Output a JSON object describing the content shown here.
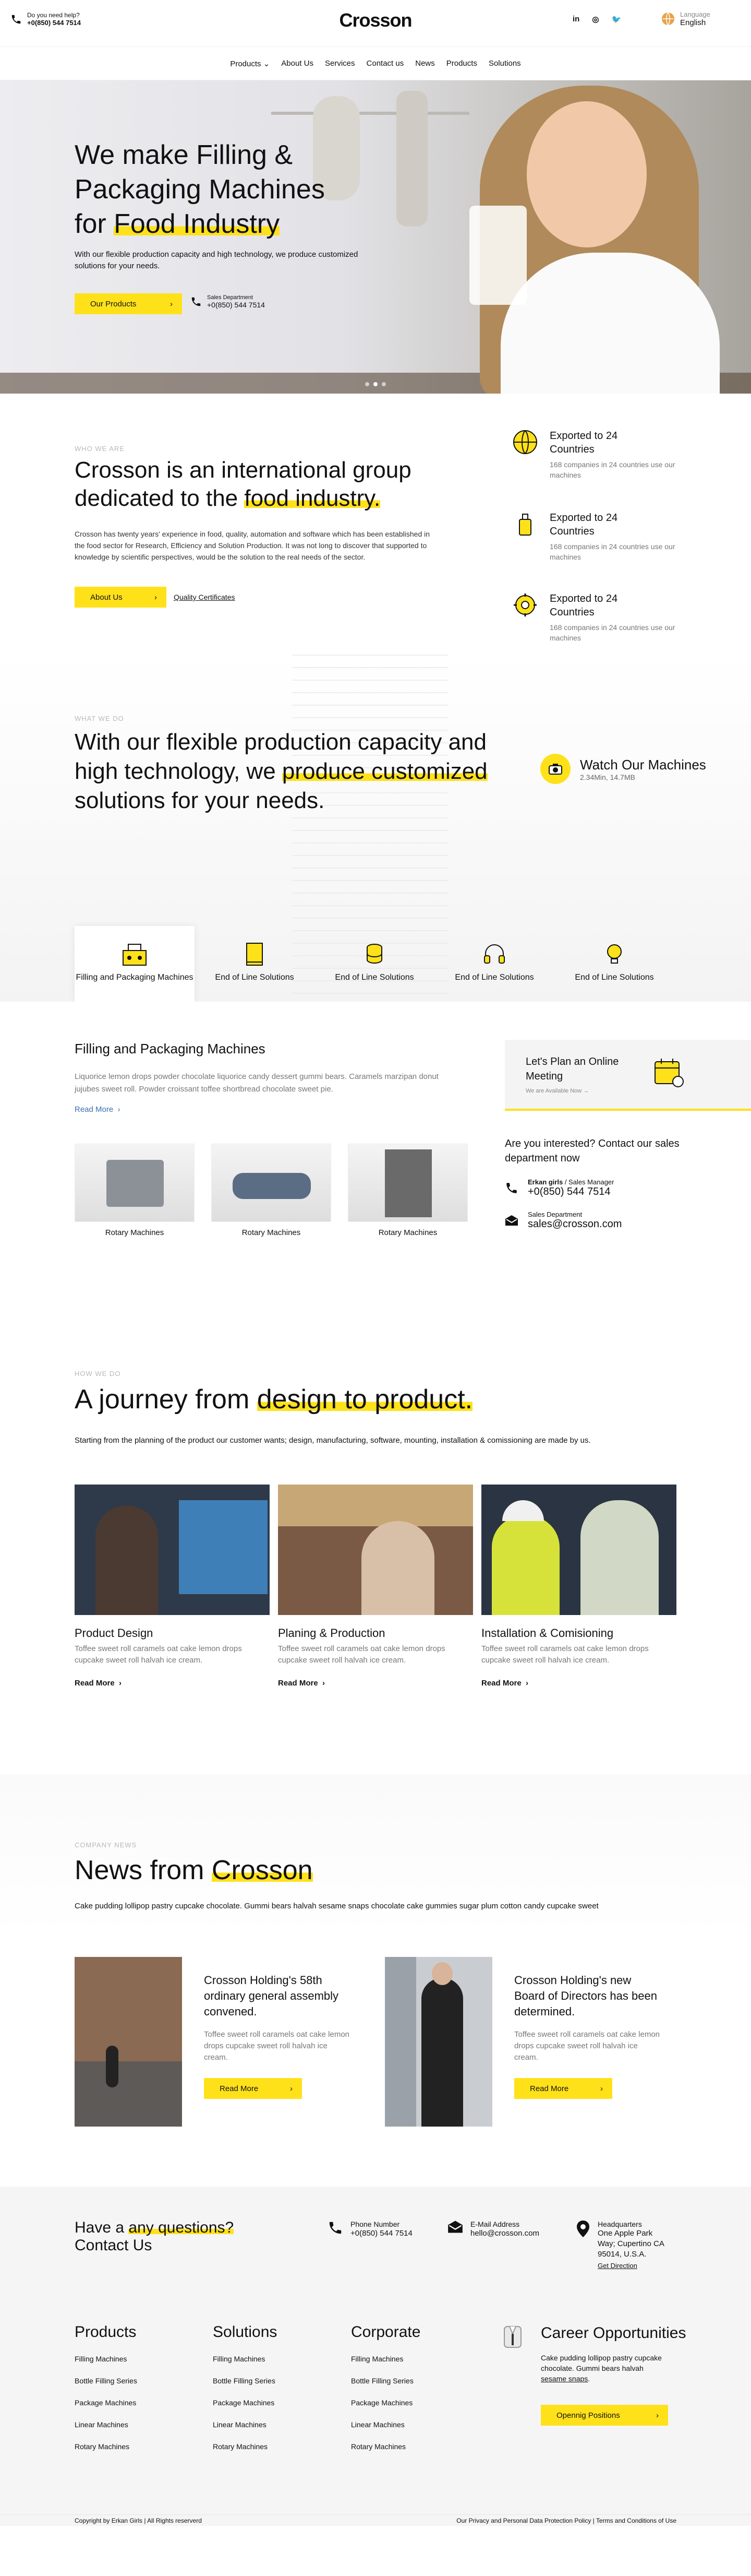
{
  "header": {
    "need_help": "Do you need help?",
    "phone": "+0(850) 544 7514",
    "logo": "Crosson",
    "socials": [
      "in",
      "◎",
      "🐦"
    ],
    "language_label": "Language",
    "language_value": "English"
  },
  "nav": {
    "items": [
      "Products",
      "About Us",
      "Services",
      "Contact us",
      "News",
      "Products",
      "Solutions"
    ]
  },
  "hero": {
    "title_line1": "We make Filling &",
    "title_line2": "Packaging Machines",
    "title_line3_prefix": "for ",
    "title_line3_highlight": "Food Industry",
    "subtitle": "With our flexible production capacity and high technology, we produce customized solutions for your needs.",
    "button": "Our Products",
    "sales_label": "Sales Department",
    "sales_phone": "+0(850) 544 7514",
    "active_slide": 2,
    "slides": 3
  },
  "who": {
    "eyebrow": "WHO WE ARE",
    "title_prefix": "Crosson is an international group dedicated to the ",
    "title_highlight": "food industry.",
    "text": "Crosson has twenty years' experience in food, quality, automation and software which has been established in the food sector for Research, Efficiency and Solution Production. It was not long to discover that supported to knowledge by scientific perspectives, would be the solution to the real needs of the sector.",
    "button": "About Us",
    "link": "Quality Certificates",
    "features": [
      {
        "icon": "globe-icon",
        "title": "Exported to 24 Countries",
        "desc": "168 companies in 24 countries use our machines"
      },
      {
        "icon": "bottle-icon",
        "title": "Exported to 24 Countries",
        "desc": "168 companies in 24 countries use our machines"
      },
      {
        "icon": "gear-icon",
        "title": "Exported to 24 Countries",
        "desc": "168 companies in 24 countries use our machines"
      }
    ]
  },
  "what": {
    "eyebrow": "WHAT WE DO",
    "title_prefix": "With our flexible production capacity and high technology, we ",
    "title_highlight": "produce customized",
    "title_suffix": " solutions for your needs.",
    "watch_title": "Watch Our Machines",
    "watch_meta": "2.34Min, 14.7MB",
    "tabs": [
      "Filling and Packaging Machines",
      "End of Line Solutions",
      "End of Line Solutions",
      "End of Line Solutions",
      "End of Line Solutions"
    ],
    "active_tab": 0
  },
  "products": {
    "title": "Filling and Packaging Machines",
    "text": "Liquorice lemon drops powder chocolate liquorice candy dessert gummi bears. Caramels marzipan donut jujubes sweet roll. Powder croissant toffee shortbread chocolate sweet pie.",
    "read_more": "Read More",
    "machines": [
      "Rotary Machines",
      "Rotary Machines",
      "Rotary Machines"
    ],
    "plan_title": "Let's Plan an Online Meeting",
    "plan_sub": "We are Available Now",
    "contact_title": "Are you interested? Contact our sales department now",
    "contact_name": "Erkan girls",
    "contact_role": " / Sales Manager",
    "contact_phone": "+0(850) 544 7514",
    "email_label": "Sales Department",
    "email": "sales@crosson.com"
  },
  "how": {
    "eyebrow": "HOW WE DO",
    "title_prefix": "A journey from ",
    "title_highlight": "design to product.",
    "text": "Starting from the planning of the product our customer wants; design, manufacturing, software, mounting, installation & comissioning are made by us.",
    "cards": [
      {
        "title": "Product Design",
        "desc": "Toffee sweet roll caramels oat cake lemon drops cupcake sweet roll halvah ice cream.",
        "more": "Read More"
      },
      {
        "title": "Planing & Production",
        "desc": "Toffee sweet roll caramels oat cake lemon drops cupcake sweet roll halvah ice cream.",
        "more": "Read More"
      },
      {
        "title": "Installation & Comisioning",
        "desc": "Toffee sweet roll caramels oat cake lemon drops cupcake sweet roll halvah ice cream.",
        "more": "Read More"
      }
    ]
  },
  "news": {
    "eyebrow": "COMPANY NEWS",
    "title_prefix": "News from ",
    "title_highlight": "Crosson",
    "text": "Cake pudding lollipop pastry cupcake chocolate. Gummi bears halvah sesame snaps chocolate cake gummies sugar plum cotton candy cupcake sweet",
    "items": [
      {
        "title": "Crosson Holding's 58th ordinary general assembly convened.",
        "desc": "Toffee sweet roll caramels oat cake lemon drops cupcake sweet roll halvah ice cream.",
        "button": "Read More"
      },
      {
        "title": "Crosson Holding's new Board of Directors has been determined.",
        "desc": "Toffee sweet roll caramels oat cake lemon drops cupcake sweet roll halvah ice cream.",
        "button": "Read More"
      }
    ]
  },
  "footer": {
    "question_prefix": "Have a ",
    "question_highlight": "any questions?",
    "question_line2": "Contact Us",
    "phone_label": "Phone Number",
    "phone": "+0(850) 544 7514",
    "email_label": "E-Mail Address",
    "email": "hello@crosson.com",
    "hq_label": "Headquarters",
    "hq_address": "One Apple Park Way; Cupertino CA 95014, U.S.A.",
    "hq_link": "Get Direction",
    "columns": [
      {
        "title": "Products",
        "items": [
          "Filling Machines",
          "Bottle Filling Series",
          "Package Machines",
          "Linear Machines",
          "Rotary Machines"
        ]
      },
      {
        "title": "Solutions",
        "items": [
          "Filling Machines",
          "Bottle Filling Series",
          "Package Machines",
          "Linear Machines",
          "Rotary Machines"
        ]
      },
      {
        "title": "Corporate",
        "items": [
          "Filling Machines",
          "Bottle Filling Series",
          "Package Machines",
          "Linear Machines",
          "Rotary Machines"
        ]
      }
    ],
    "career_title": "Career Opportunities",
    "career_desc_prefix": "Cake pudding lollipop pastry cupcake chocolate. Gummi bears halvah ",
    "career_desc_link": "sesame snaps",
    "career_desc_suffix": ".",
    "career_button": "Opennig Positions",
    "copyright": "Copyright by Erkan Girls | All Rights reserverd",
    "legal": "Our Privacy and Personal Data Protection Policy | Terms and Conditions of Use"
  },
  "colors": {
    "accent": "#ffe11a",
    "text": "#111111",
    "muted": "#777777",
    "link": "#3a6fb0"
  }
}
